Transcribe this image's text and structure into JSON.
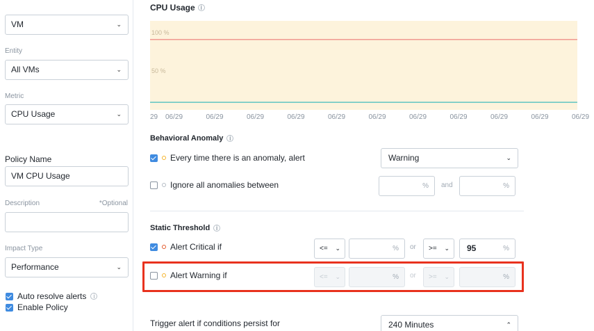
{
  "left": {
    "type_select": {
      "value": "VM"
    },
    "entity": {
      "label": "Entity",
      "value": "All VMs"
    },
    "metric": {
      "label": "Metric",
      "value": "CPU Usage"
    },
    "policy_name": {
      "label": "Policy Name",
      "value": "VM CPU Usage"
    },
    "description": {
      "label": "Description",
      "optional": "*Optional",
      "value": ""
    },
    "impact_type": {
      "label": "Impact Type",
      "value": "Performance"
    },
    "auto_resolve": {
      "label": "Auto resolve alerts",
      "checked": true
    },
    "enable_policy": {
      "label": "Enable Policy",
      "checked": true
    }
  },
  "chart": {
    "title": "CPU Usage",
    "y_labels": [
      "100 %",
      "50 %"
    ],
    "x_ticks": [
      "29",
      "06/29",
      "06/29",
      "06/29",
      "06/29",
      "06/29",
      "06/29",
      "06/29",
      "06/29",
      "06/29",
      "06/29",
      "06/29"
    ]
  },
  "chart_data": {
    "type": "line",
    "title": "CPU Usage",
    "x": [
      "29",
      "06/29",
      "06/29",
      "06/29",
      "06/29",
      "06/29",
      "06/29",
      "06/29",
      "06/29",
      "06/29",
      "06/29",
      "06/29"
    ],
    "ylim": [
      0,
      100
    ],
    "y_ticks": [
      100,
      50
    ],
    "series": [
      {
        "values": [
          3,
          3,
          3,
          3,
          3,
          3,
          3,
          3,
          3,
          3,
          3,
          3
        ],
        "color": "#5ec4c2"
      }
    ],
    "threshold_line": {
      "value": 95,
      "color": "#e86a6a"
    },
    "band_color": "#fdf3dc",
    "grid": true
  },
  "behavioral": {
    "title": "Behavioral Anomaly",
    "every_time": {
      "label": "Every time there is an anomaly, alert",
      "checked": true,
      "severity": "Warning"
    },
    "ignore": {
      "label": "Ignore all anomalies between",
      "checked": false,
      "from": "",
      "to": "",
      "unit": "%",
      "and_text": "and"
    }
  },
  "static": {
    "title": "Static Threshold",
    "critical": {
      "label": "Alert Critical if",
      "checked": true,
      "op1": "<=",
      "val1": "",
      "or_text": "or",
      "op2": ">=",
      "val2": "95",
      "unit": "%"
    },
    "warning": {
      "label": "Alert Warning if",
      "checked": false,
      "op1": "<=",
      "val1": "",
      "or_text": "or",
      "op2": ">=",
      "val2": "",
      "unit": "%"
    }
  },
  "trigger": {
    "label": "Trigger alert if conditions persist for",
    "value": "240 Minutes"
  },
  "colors": {
    "accent": "#3f8be0",
    "highlight": "#e8321e",
    "warning_dot": "#f5b32a",
    "critical_dot": "#e35a2c"
  }
}
